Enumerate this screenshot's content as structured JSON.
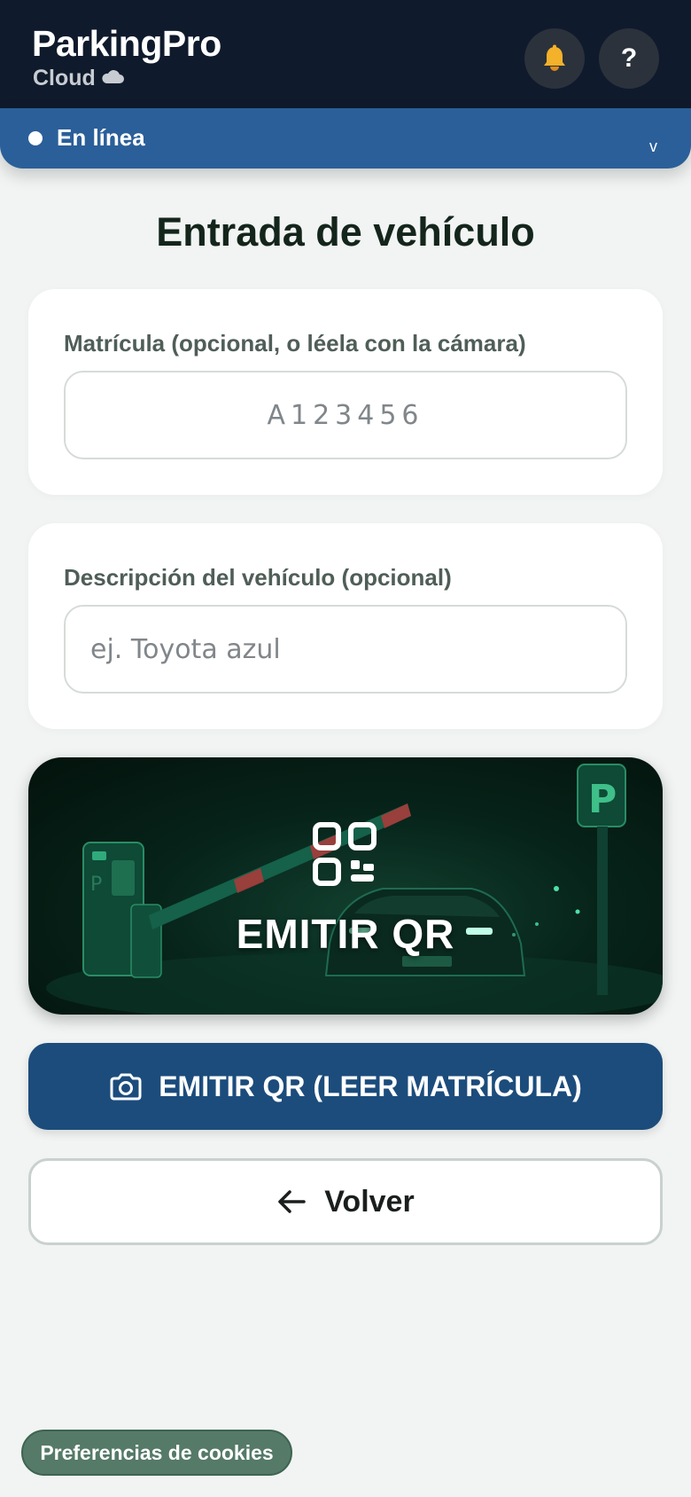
{
  "header": {
    "brand": "ParkingPro",
    "sub": "Cloud",
    "help_label": "?"
  },
  "status": {
    "label": "En línea",
    "chevron": "v"
  },
  "page": {
    "title": "Entrada de vehículo"
  },
  "form": {
    "plate_label": "Matrícula (opcional, o léela con la cámara)",
    "plate_placeholder": "A123456",
    "desc_label": "Descripción del vehículo (opcional)",
    "desc_placeholder": "ej. Toyota azul"
  },
  "hero": {
    "label": "EMITIR QR",
    "icon": "qr-code-icon"
  },
  "buttons": {
    "scan_label": "EMITIR QR (LEER MATRÍCULA)",
    "scan_icon": "camera-icon",
    "back_label": "Volver",
    "back_icon": "arrow-left-icon"
  },
  "footer": {
    "cookies_label": "Preferencias de cookies"
  },
  "colors": {
    "header_bg": "#0f1a2c",
    "status_bg": "#2b5f99",
    "primary_button": "#1c4c7c",
    "cookie_button": "#557a68",
    "hero_accent": "#2fbf80"
  }
}
